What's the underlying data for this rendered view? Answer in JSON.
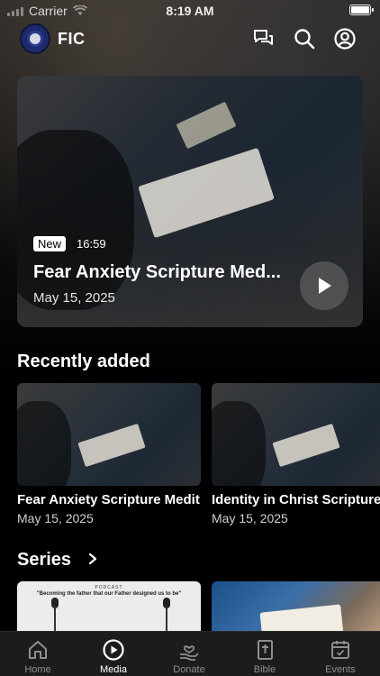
{
  "status_bar": {
    "carrier": "Carrier",
    "time": "8:19 AM"
  },
  "header": {
    "app_name": "FIC",
    "icons": [
      "chat-icon",
      "search-icon",
      "profile-icon"
    ]
  },
  "hero": {
    "badge_new": "New",
    "duration": "16:59",
    "title": "Fear Anxiety Scripture Med...",
    "date": "May 15, 2025"
  },
  "recently_added": {
    "title": "Recently added",
    "items": [
      {
        "title": "Fear Anxiety Scripture Medit",
        "date": "May 15, 2025"
      },
      {
        "title": "Identity in Christ Scripture",
        "date": "May 15, 2025"
      }
    ]
  },
  "series": {
    "title": "Series",
    "items": [
      {
        "podcast": "PODCAST",
        "quote": "\"Becoming the father that our Father designed us to be\""
      }
    ]
  },
  "tabs": [
    {
      "label": "Home",
      "icon": "home-icon"
    },
    {
      "label": "Media",
      "icon": "play-circle-icon"
    },
    {
      "label": "Donate",
      "icon": "donate-icon"
    },
    {
      "label": "Bible",
      "icon": "bible-icon"
    },
    {
      "label": "Events",
      "icon": "calendar-icon"
    }
  ],
  "active_tab": "Media",
  "colors": {
    "background": "#000000",
    "tab_bar": "#1c1c1e",
    "inactive_tab": "#8e8e93",
    "active_tab": "#ffffff"
  }
}
